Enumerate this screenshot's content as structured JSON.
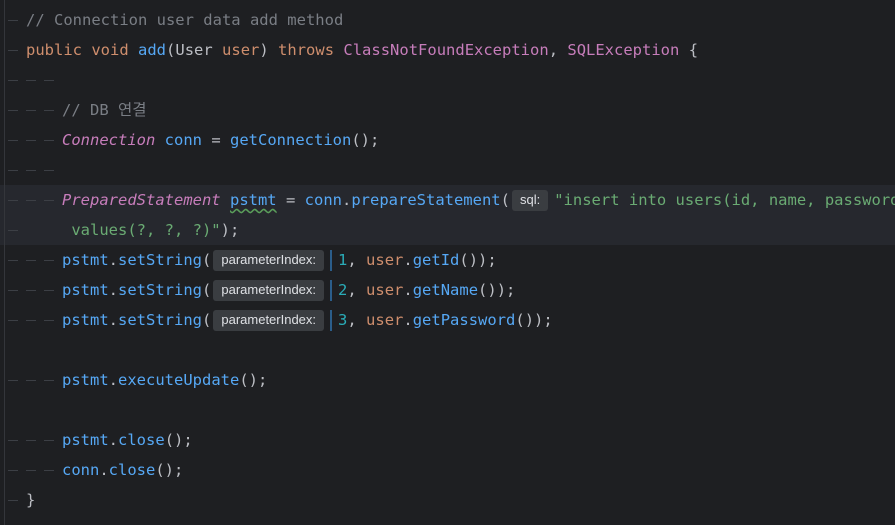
{
  "editor": {
    "comment_line": "// Connection user data add method",
    "method_sig": {
      "mod1": "public",
      "mod2": "void",
      "name": "add",
      "param_type": "User",
      "param_name": "user",
      "throws_kw": "throws",
      "exc1": "ClassNotFoundException",
      "exc2": "SQLException",
      "open_brace": "{"
    },
    "db_comment": "// DB 연결",
    "conn_line": {
      "type": "Connection",
      "var": "conn",
      "call": "getConnection",
      "rest": "();"
    },
    "ps_line": {
      "type": "PreparedStatement",
      "var": "pstmt",
      "obj": "conn",
      "call": "prepareStatement",
      "hint": "sql:",
      "string_part1": "\"insert into users(id, name, password)",
      "string_part2": " values(?, ?, ?)\"",
      "end": ");"
    },
    "set_lines": [
      {
        "obj": "pstmt",
        "call": "setString",
        "hint": "parameterIndex:",
        "index": "1",
        "target": "user",
        "getter": "getId",
        "end": "());"
      },
      {
        "obj": "pstmt",
        "call": "setString",
        "hint": "parameterIndex:",
        "index": "2",
        "target": "user",
        "getter": "getName",
        "end": "());"
      },
      {
        "obj": "pstmt",
        "call": "setString",
        "hint": "parameterIndex:",
        "index": "3",
        "target": "user",
        "getter": "getPassword",
        "end": "());"
      }
    ],
    "exec_line": {
      "obj": "pstmt",
      "call": "executeUpdate",
      "end": "();"
    },
    "close_lines": [
      {
        "obj": "pstmt",
        "call": "close",
        "end": "();"
      },
      {
        "obj": "conn",
        "call": "close",
        "end": "();"
      }
    ],
    "close_brace": "}"
  }
}
